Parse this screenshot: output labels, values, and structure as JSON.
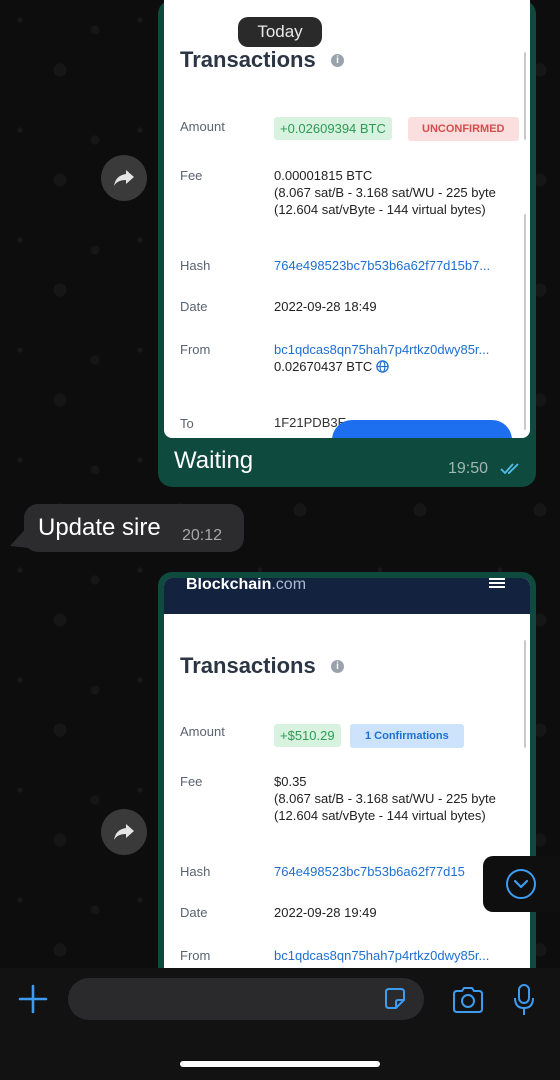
{
  "date_separator": "Today",
  "message1": {
    "card": {
      "title": "Transactions",
      "amount_label": "Amount",
      "amount_value": "+0.02609394 BTC",
      "status": "UNCONFIRMED",
      "fee_label": "Fee",
      "fee_lines": [
        "0.00001815 BTC",
        "(8.067 sat/B - 3.168 sat/WU - 225 byte",
        "(12.604 sat/vByte - 144 virtual bytes)"
      ],
      "hash_label": "Hash",
      "hash_value": "764e498523bc7b53b6a62f77d15b7...",
      "date_label": "Date",
      "date_value": "2022-09-28 18:49",
      "from_label": "From",
      "from_address": "bc1qdcas8qn75hah7p4rtkz0dwy85r...",
      "from_amount": "0.02670437 BTC",
      "to_label": "To",
      "to_address": "1F21PDB3E..."
    },
    "caption": "Waiting",
    "time": "19:50"
  },
  "message2": {
    "text": "Update sire",
    "time": "20:12"
  },
  "message3": {
    "card": {
      "brand_bold": "Blockchain",
      "brand_light": ".com",
      "title": "Transactions",
      "amount_label": "Amount",
      "amount_value": "+$510.29",
      "status": "1 Confirmations",
      "fee_label": "Fee",
      "fee_lines": [
        "$0.35",
        "(8.067 sat/B - 3.168 sat/WU - 225 byte",
        "(12.604 sat/vByte - 144 virtual bytes)"
      ],
      "hash_label": "Hash",
      "hash_value": "764e498523bc7b53b6a62f77d15",
      "date_label": "Date",
      "date_value": "2022-09-28 19:49",
      "from_label": "From",
      "from_address": "bc1qdcas8qn75hah7p4rtkz0dwy85r..."
    }
  },
  "icons": {
    "forward": "forward-arrow-icon",
    "read": "double-check-icon",
    "attach": "plus-icon",
    "sticker": "sticker-icon",
    "camera": "camera-icon",
    "mic": "microphone-icon",
    "scroll": "chevron-down-icon",
    "globe": "globe-icon",
    "menu": "hamburger-menu-icon"
  },
  "colors": {
    "outgoing_bubble": "#0f4a3e",
    "incoming_bubble": "#2c2c2e",
    "accent_blue": "#3d9cf0"
  }
}
